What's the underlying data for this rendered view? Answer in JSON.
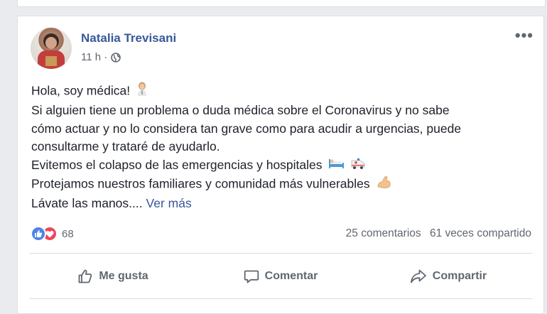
{
  "post": {
    "author": "Natalia Trevisani",
    "time": "11 h ·",
    "lines": [
      "Hola, soy médica!",
      "Si alguien tiene un problema o duda médica sobre el Coronavirus y no sabe",
      "cómo actuar y no lo considera tan grave como para acudir a urgencias, puede",
      "consultarme y trataré de ayudarlo.",
      "Evitemos el colapso de las emergencias y hospitales",
      "Protejamos nuestros familiares y comunidad más vulnerables",
      "Lávate las manos...."
    ],
    "see_more": "Ver más",
    "reaction_count": "68",
    "comments": "25 comentarios",
    "shares": "61 veces compartido"
  },
  "actions": {
    "like": "Me gusta",
    "comment": "Comentar",
    "share": "Compartir"
  },
  "icons": [
    "globe-icon",
    "more-options-icon",
    "doctor-emoji-icon",
    "hospital-bed-emoji-icon",
    "ambulance-emoji-icon",
    "flexed-biceps-emoji-icon",
    "like-reaction-icon",
    "love-reaction-icon",
    "thumbs-up-icon",
    "comment-icon",
    "share-icon"
  ],
  "colors": {
    "author_link": "#385898",
    "like_reaction": "#4e84e8",
    "love_reaction": "#f0455b"
  }
}
